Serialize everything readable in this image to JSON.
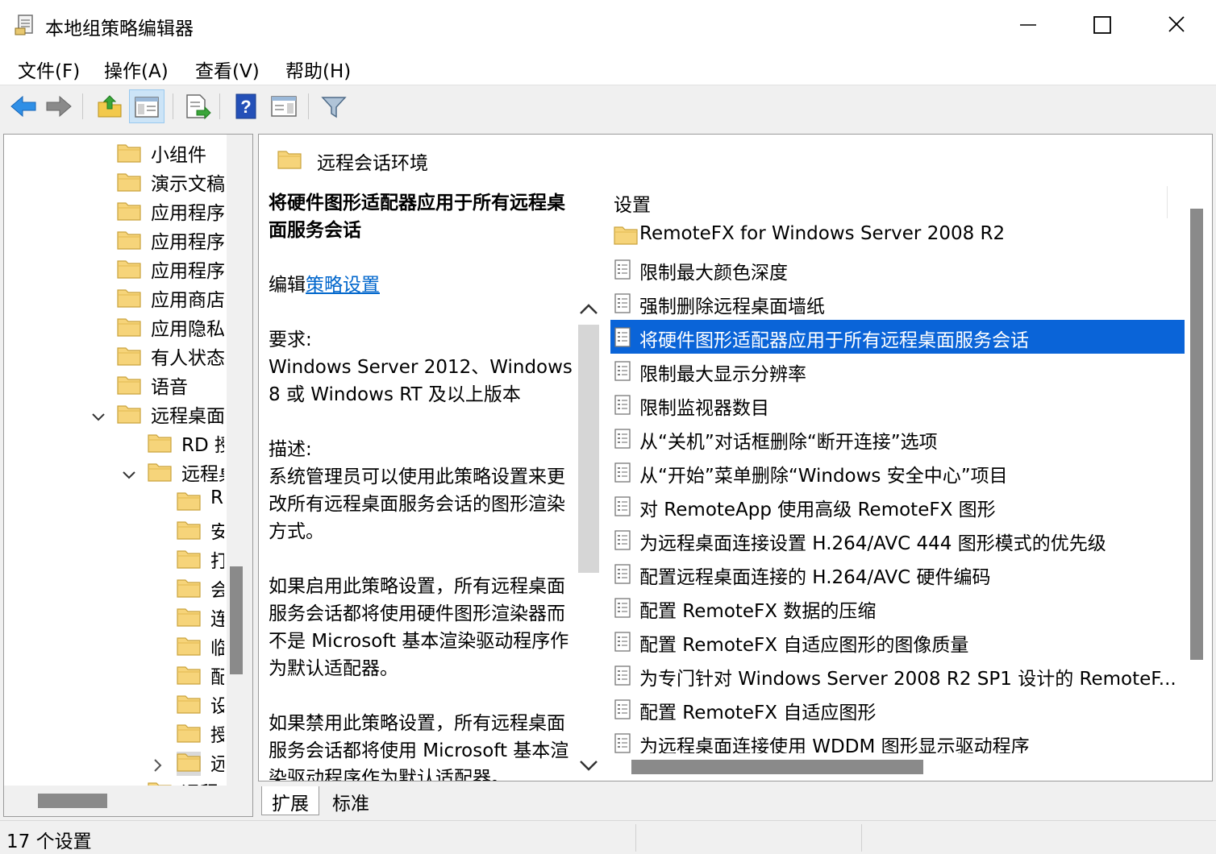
{
  "window": {
    "title": "本地组策略编辑器",
    "icon": "policy-editor-icon"
  },
  "menu": {
    "file": "文件(F)",
    "action": "操作(A)",
    "view": "查看(V)",
    "help": "帮助(H)"
  },
  "toolbar": {
    "buttons": [
      "back-arrow-icon",
      "forward-arrow-icon",
      "up-folder-icon",
      "show-hide-tree-icon",
      "export-list-icon",
      "help-icon",
      "show-hide-action-pane-icon",
      "filter-icon"
    ]
  },
  "tree": {
    "items": [
      {
        "label": "小组件",
        "level": 0
      },
      {
        "label": "演示文稿",
        "level": 0
      },
      {
        "label": "应用程序",
        "level": 0
      },
      {
        "label": "应用程序",
        "level": 0
      },
      {
        "label": "应用程序",
        "level": 0
      },
      {
        "label": "应用商店",
        "level": 0
      },
      {
        "label": "应用隐私",
        "level": 0
      },
      {
        "label": "有人状态",
        "level": 0
      },
      {
        "label": "语音",
        "level": 0
      },
      {
        "label": "远程桌面",
        "level": 0,
        "expanded": true
      },
      {
        "label": "RD 授",
        "level": 1
      },
      {
        "label": "远程桌",
        "level": 1,
        "expanded": true
      },
      {
        "label": "R",
        "level": 2
      },
      {
        "label": "安",
        "level": 2
      },
      {
        "label": "打",
        "level": 2
      },
      {
        "label": "会",
        "level": 2
      },
      {
        "label": "连",
        "level": 2
      },
      {
        "label": "临",
        "level": 2
      },
      {
        "label": "配",
        "level": 2
      },
      {
        "label": "设",
        "level": 2
      },
      {
        "label": "授",
        "level": 2
      },
      {
        "label": "远",
        "level": 2,
        "collapsed": true,
        "selected": true
      },
      {
        "label": "远程",
        "level": 1
      }
    ]
  },
  "right": {
    "path_title": "远程会话环境",
    "description": {
      "title": "将硬件图形适配器应用于所有远程桌面服务会话",
      "edit_prefix": "编辑",
      "edit_link": "策略设置",
      "requirements_label": "要求:",
      "requirements_text": "Windows Server 2012、Windows 8 或 Windows RT 及以上版本",
      "description_label": "描述:",
      "description_text": "系统管理员可以使用此策略设置来更改所有远程桌面服务会话的图形渲染方式。",
      "enabled_text": "如果启用此策略设置，所有远程桌面服务会话都将使用硬件图形渲染器而不是 Microsoft 基本渲染驱动程序作为默认适配器。",
      "disabled_text": "如果禁用此策略设置，所有远程桌面服务会话都将使用 Microsoft 基本渲染驱动程序作为默认适配器。"
    },
    "list": {
      "header": "设置",
      "rows": [
        {
          "label": "RemoteFX for Windows Server 2008 R2",
          "icon": "folder-icon"
        },
        {
          "label": "限制最大颜色深度",
          "icon": "policy-setting-icon"
        },
        {
          "label": "强制删除远程桌面墙纸",
          "icon": "policy-setting-icon"
        },
        {
          "label": "将硬件图形适配器应用于所有远程桌面服务会话",
          "icon": "policy-setting-icon",
          "selected": true
        },
        {
          "label": "限制最大显示分辨率",
          "icon": "policy-setting-icon"
        },
        {
          "label": "限制监视器数目",
          "icon": "policy-setting-icon"
        },
        {
          "label": "从“关机”对话框删除“断开连接”选项",
          "icon": "policy-setting-icon"
        },
        {
          "label": "从“开始”菜单删除“Windows 安全中心”项目",
          "icon": "policy-setting-icon"
        },
        {
          "label": "对 RemoteApp 使用高级 RemoteFX 图形",
          "icon": "policy-setting-icon"
        },
        {
          "label": "为远程桌面连接设置 H.264/AVC 444 图形模式的优先级",
          "icon": "policy-setting-icon"
        },
        {
          "label": "配置远程桌面连接的 H.264/AVC 硬件编码",
          "icon": "policy-setting-icon"
        },
        {
          "label": "配置 RemoteFX 数据的压缩",
          "icon": "policy-setting-icon"
        },
        {
          "label": "配置 RemoteFX 自适应图形的图像质量",
          "icon": "policy-setting-icon"
        },
        {
          "label": "为专门针对 Windows Server 2008 R2 SP1 设计的 RemoteF...",
          "icon": "policy-setting-icon"
        },
        {
          "label": "配置 RemoteFX 自适应图形",
          "icon": "policy-setting-icon"
        },
        {
          "label": "为远程桌面连接使用 WDDM 图形显示驱动程序",
          "icon": "policy-setting-icon"
        }
      ]
    }
  },
  "tabs": {
    "expanded": "扩展",
    "standard": "标准"
  },
  "status": {
    "text": "17 个设置"
  },
  "colors": {
    "selection": "#0a64d8",
    "link": "#0066cc",
    "folder": "#f6d47a"
  }
}
